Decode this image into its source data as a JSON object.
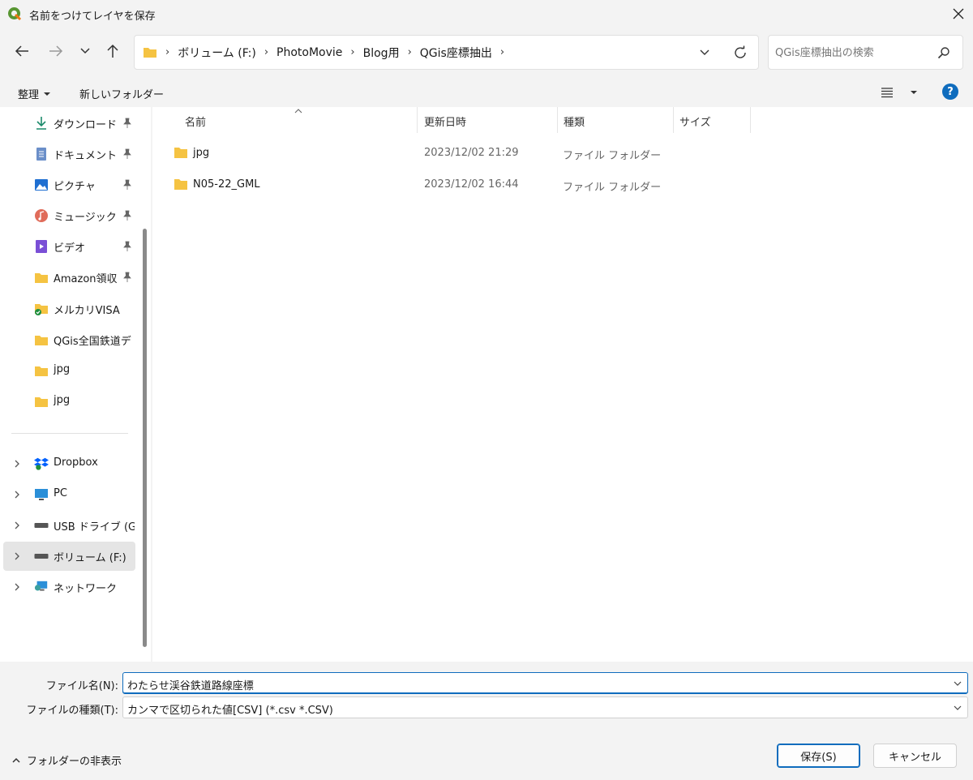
{
  "window": {
    "title": "名前をつけてレイヤを保存"
  },
  "address": {
    "crumbs": [
      "ボリューム (F:)",
      "PhotoMovie",
      "Blog用",
      "QGis座標抽出"
    ]
  },
  "search": {
    "placeholder": "QGis座標抽出の検索"
  },
  "toolbar": {
    "organize_label": "整理",
    "new_folder_label": "新しいフォルダー"
  },
  "sidebar": {
    "quick": [
      {
        "label": "ダウンロード",
        "icon": "download-icon",
        "pinned": true
      },
      {
        "label": "ドキュメント",
        "icon": "document-icon",
        "pinned": true
      },
      {
        "label": "ピクチャ",
        "icon": "picture-icon",
        "pinned": true
      },
      {
        "label": "ミュージック",
        "icon": "music-icon",
        "pinned": true
      },
      {
        "label": "ビデオ",
        "icon": "video-icon",
        "pinned": true
      },
      {
        "label": "Amazon領収",
        "icon": "folder-icon",
        "pinned": true
      },
      {
        "label": "メルカリVISA",
        "icon": "folder-synced-icon",
        "pinned": false
      },
      {
        "label": "QGis全国鉄道デ",
        "icon": "folder-icon",
        "pinned": false
      },
      {
        "label": "jpg",
        "icon": "folder-icon",
        "pinned": false
      },
      {
        "label": "jpg",
        "icon": "folder-icon",
        "pinned": false
      }
    ],
    "locations": [
      {
        "label": "Dropbox",
        "icon": "dropbox-icon"
      },
      {
        "label": "PC",
        "icon": "pc-icon"
      },
      {
        "label": "USB ドライブ (G:)",
        "icon": "drive-icon"
      },
      {
        "label": "ボリューム (F:)",
        "icon": "drive-icon",
        "selected": true
      },
      {
        "label": "ネットワーク",
        "icon": "network-icon"
      }
    ]
  },
  "filelist": {
    "columns": [
      "名前",
      "更新日時",
      "種類",
      "サイズ"
    ],
    "rows": [
      {
        "name": "jpg",
        "modified": "2023/12/02 21:29",
        "type": "ファイル フォルダー",
        "size": ""
      },
      {
        "name": "N05-22_GML",
        "modified": "2023/12/02 16:44",
        "type": "ファイル フォルダー",
        "size": ""
      }
    ]
  },
  "form": {
    "filename_label": "ファイル名(N):",
    "filename_value": "わたらせ渓谷鉄道路線座標",
    "filetype_label": "ファイルの種類(T):",
    "filetype_value": "カンマで区切られた値[CSV] (*.csv *.CSV)"
  },
  "footer": {
    "hide_folders_label": "フォルダーの非表示",
    "save_label": "保存(S)",
    "cancel_label": "キャンセル"
  },
  "colors": {
    "accent": "#0f6cbd",
    "folder": "#f5c342",
    "qgis_green": "#589632"
  }
}
